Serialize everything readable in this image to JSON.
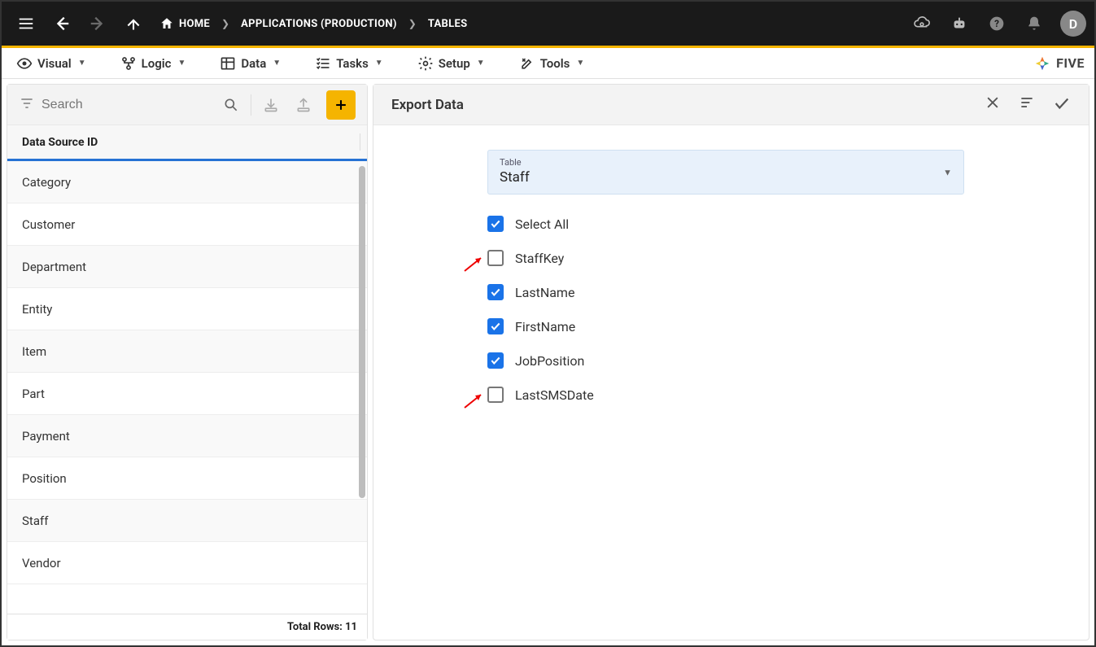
{
  "topnav": {
    "breadcrumbs": [
      {
        "label": "HOME"
      },
      {
        "label": "APPLICATIONS (PRODUCTION)"
      },
      {
        "label": "TABLES"
      }
    ],
    "avatar_letter": "D"
  },
  "submenu": {
    "items": [
      {
        "label": "Visual"
      },
      {
        "label": "Logic"
      },
      {
        "label": "Data"
      },
      {
        "label": "Tasks"
      },
      {
        "label": "Setup"
      },
      {
        "label": "Tools"
      }
    ],
    "brand": "FIVE"
  },
  "left": {
    "search_placeholder": "Search",
    "column_header": "Data Source ID",
    "rows": [
      "Category",
      "Customer",
      "Department",
      "Entity",
      "Item",
      "Part",
      "Payment",
      "Position",
      "Staff",
      "Vendor"
    ],
    "footer_label": "Total Rows:",
    "footer_value": "11"
  },
  "right": {
    "title": "Export Data",
    "table_field": {
      "label": "Table",
      "value": "Staff"
    },
    "fields": [
      {
        "label": "Select All",
        "checked": true,
        "arrow": false
      },
      {
        "label": "StaffKey",
        "checked": false,
        "arrow": true
      },
      {
        "label": "LastName",
        "checked": true,
        "arrow": false
      },
      {
        "label": "FirstName",
        "checked": true,
        "arrow": false
      },
      {
        "label": "JobPosition",
        "checked": true,
        "arrow": false
      },
      {
        "label": "LastSMSDate",
        "checked": false,
        "arrow": true
      }
    ]
  }
}
